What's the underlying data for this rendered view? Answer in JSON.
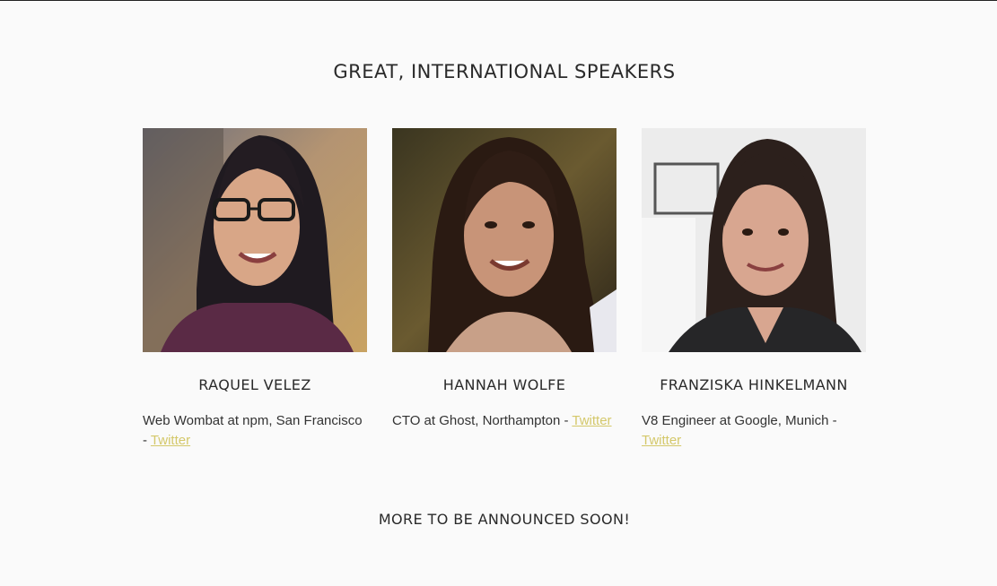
{
  "section_title": "GREAT, INTERNATIONAL SPEAKERS",
  "speakers": [
    {
      "name": "RAQUEL VELEZ",
      "info_text": "Web Wombat at npm, San Francisco - ",
      "link_label": "Twitter"
    },
    {
      "name": "HANNAH WOLFE",
      "info_text": "CTO at Ghost, Northampton - ",
      "link_label": "Twitter"
    },
    {
      "name": "FRANZISKA HINKELMANN",
      "info_text": "V8 Engineer at Google, Munich - ",
      "link_label": "Twitter"
    }
  ],
  "more_soon": "MORE TO BE ANNOUNCED SOON!",
  "colors": {
    "background": "#fafafa",
    "link": "#d4c86a",
    "heading": "#2a2a2a"
  }
}
